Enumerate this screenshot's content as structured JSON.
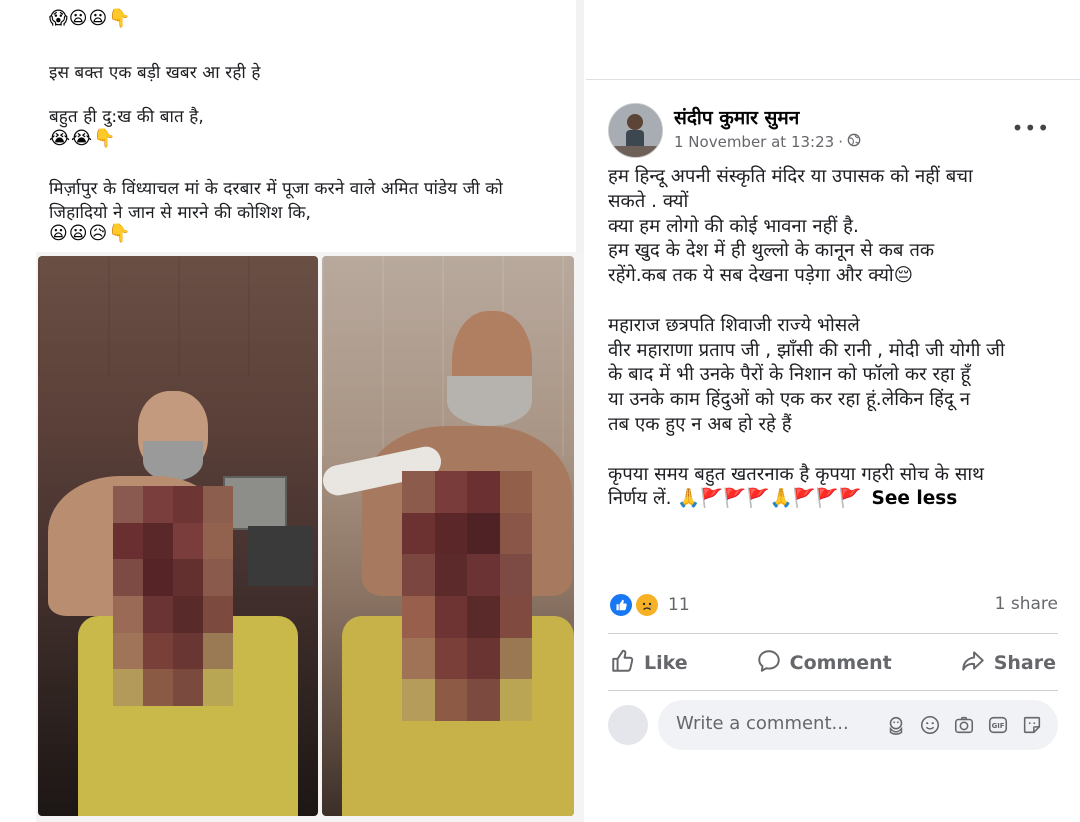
{
  "screenshot_text": {
    "emoji_line_1": "😱😦😦👇",
    "line_1": "इस बक्त एक बड़ी खबर आ रही हे",
    "line_2": "बहुत ही दु:ख की बात है,",
    "emoji_line_2": "😭😭👇",
    "line_3": "मिर्ज़ापुर के विंध्याचल मां के दरबार में पूजा करने वाले अमित पांडेय जी को",
    "line_4": "जिहादियो ने जान से मारने की कोशिश कि,",
    "emoji_line_3": "😦😦😥👇"
  },
  "post": {
    "author": "संदीप कुमार सुमन",
    "timestamp": "1 November at 13:23",
    "separator": "·",
    "audience_icon": "globe-icon",
    "more_icon": "more-options-icon",
    "more_label": "•••",
    "body_lines": [
      "हम हिन्दू अपनी संस्कृति मंदिर या उपासक को नहीं बचा",
      "सकते . क्यों",
      "क्या हम लोगो की कोई भावना नहीं है.",
      "हम खुद के देश में ही थुल्लो के कानून से कब तक",
      "रहेंगे.कब तक ये सब देखना पड़ेगा और क्यो😔",
      "",
      "महाराज छत्रपति शिवाजी राज्ये भोसले",
      "वीर महाराणा प्रताप जी , झाँसी की रानी , मोदी जी योगी जी",
      "के बाद में भी उनके पैरों के निशान को फॉलो कर रहा हूँ",
      "या उनके काम हिंदुओं को एक कर रहा हूं.लेकिन हिंदू न",
      "तब एक हुए न अब हो रहे हैं",
      "",
      "कृपया समय बहुत खतरनाक है कृपया गहरी सोच के साथ"
    ],
    "last_line": "निर्णय लें. 🙏🚩🚩🚩🙏🚩🚩🚩",
    "see_less": "See less",
    "reaction_count": "11",
    "share_count": "1 share",
    "actions": {
      "like": "Like",
      "comment": "Comment",
      "share": "Share"
    },
    "comment_placeholder": "Write a comment...",
    "comment_tools": [
      "avatar-sticker-icon",
      "emoji-icon",
      "camera-icon",
      "gif-icon",
      "sticker-icon"
    ]
  },
  "colors": {
    "facebook_blue": "#1877f2",
    "secondary_text": "#65676b",
    "comment_box": "#f0f2f5"
  }
}
